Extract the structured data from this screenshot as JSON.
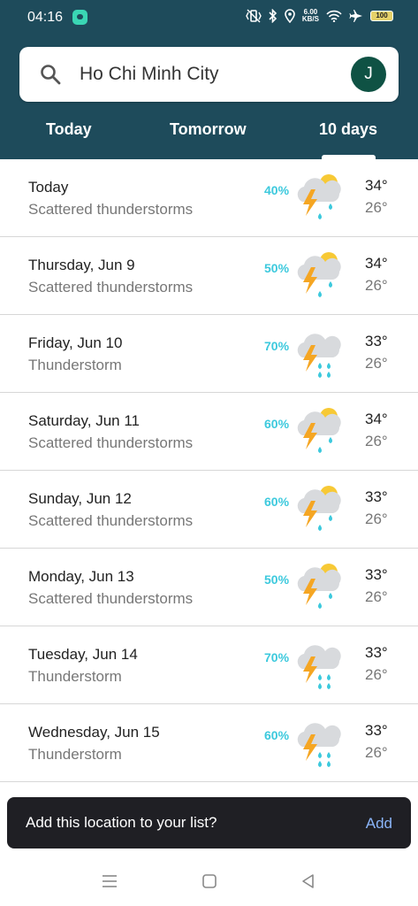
{
  "status": {
    "time": "04:16",
    "speed_value": "6.00",
    "speed_unit": "KB/S",
    "battery": "100",
    "icons": [
      "chat-bubble-icon",
      "vibrate-icon",
      "bluetooth-icon",
      "location-icon",
      "wifi-icon",
      "airplane-icon",
      "battery-icon"
    ]
  },
  "search": {
    "value": "Ho Chi Minh City",
    "avatar_letter": "J"
  },
  "tabs": [
    {
      "label": "Today"
    },
    {
      "label": "Tomorrow"
    },
    {
      "label": "10 days",
      "selected": true
    }
  ],
  "forecast": [
    {
      "day": "Today",
      "condition": "Scattered thunderstorms",
      "precip": "40%",
      "high": "34°",
      "low": "26°",
      "icon": "scattered-thunderstorm-icon"
    },
    {
      "day": "Thursday, Jun 9",
      "condition": "Scattered thunderstorms",
      "precip": "50%",
      "high": "34°",
      "low": "26°",
      "icon": "scattered-thunderstorm-icon"
    },
    {
      "day": "Friday, Jun 10",
      "condition": "Thunderstorm",
      "precip": "70%",
      "high": "33°",
      "low": "26°",
      "icon": "thunderstorm-icon"
    },
    {
      "day": "Saturday, Jun 11",
      "condition": "Scattered thunderstorms",
      "precip": "60%",
      "high": "34°",
      "low": "26°",
      "icon": "scattered-thunderstorm-icon"
    },
    {
      "day": "Sunday, Jun 12",
      "condition": "Scattered thunderstorms",
      "precip": "60%",
      "high": "33°",
      "low": "26°",
      "icon": "scattered-thunderstorm-icon"
    },
    {
      "day": "Monday, Jun 13",
      "condition": "Scattered thunderstorms",
      "precip": "50%",
      "high": "33°",
      "low": "26°",
      "icon": "scattered-thunderstorm-icon"
    },
    {
      "day": "Tuesday, Jun 14",
      "condition": "Thunderstorm",
      "precip": "70%",
      "high": "33°",
      "low": "26°",
      "icon": "thunderstorm-icon"
    },
    {
      "day": "Wednesday, Jun 15",
      "condition": "Thunderstorm",
      "precip": "60%",
      "high": "33°",
      "low": "26°",
      "icon": "thunderstorm-icon"
    }
  ],
  "snackbar": {
    "message": "Add this location to your list?",
    "action": "Add"
  },
  "colors": {
    "header_bg": "#1e4b5b",
    "precip": "#3cc9dd",
    "avatar_bg": "#0f5244",
    "snackbar_bg": "#1f1f24",
    "snackbar_action": "#8ab4f8",
    "sun": "#f7c935",
    "bolt": "#f5a623",
    "cloud": "#d8dadd",
    "rain": "#3cc9dd"
  }
}
